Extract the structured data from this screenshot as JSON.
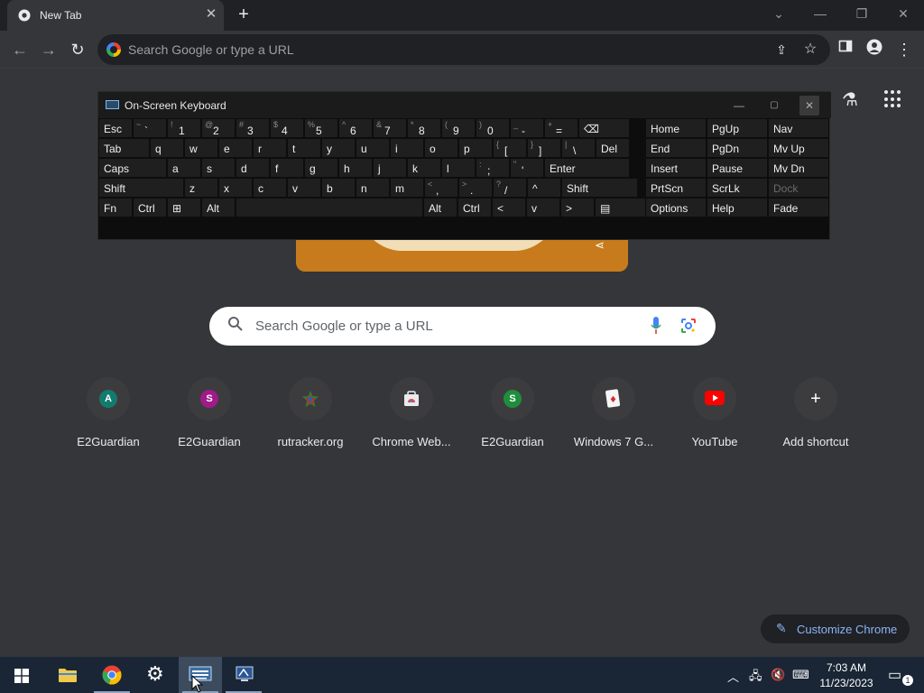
{
  "browser": {
    "tab_title": "New Tab",
    "tab_close": "✕",
    "new_tab": "+",
    "omnibox_placeholder": "Search Google or type a URL"
  },
  "ntp": {
    "search_placeholder": "Search Google or type a URL",
    "shortcuts": [
      {
        "label": "E2Guardian",
        "letter": "A",
        "color": "#137a6e"
      },
      {
        "label": "E2Guardian",
        "letter": "S",
        "color": "#a01a8a"
      },
      {
        "label": "rutracker.org",
        "letter": "",
        "color": "#3a3a3a"
      },
      {
        "label": "Chrome Web...",
        "letter": "",
        "color": "#3a3a3a"
      },
      {
        "label": "E2Guardian",
        "letter": "S",
        "color": "#1e8e3e"
      },
      {
        "label": "Windows 7 G...",
        "letter": "",
        "color": "#3a3a3a"
      },
      {
        "label": "YouTube",
        "letter": "",
        "color": "#ff0000"
      },
      {
        "label": "Add shortcut",
        "letter": "+",
        "color": "#3c3c3f"
      }
    ],
    "customize_label": "Customize Chrome"
  },
  "osk": {
    "title": "On-Screen Keyboard",
    "rows": [
      [
        [
          "Esc",
          ""
        ],
        [
          "`",
          "~"
        ],
        [
          "1",
          "!"
        ],
        [
          "2",
          "@"
        ],
        [
          "3",
          "#"
        ],
        [
          "4",
          "$"
        ],
        [
          "5",
          "%"
        ],
        [
          "6",
          "^"
        ],
        [
          "7",
          "&"
        ],
        [
          "8",
          "*"
        ],
        [
          "9",
          "("
        ],
        [
          "0",
          ")"
        ],
        [
          "-",
          "_"
        ],
        [
          "=",
          "+"
        ],
        [
          "⌫",
          ""
        ]
      ],
      [
        [
          "Tab",
          ""
        ],
        [
          "q",
          ""
        ],
        [
          "w",
          ""
        ],
        [
          "e",
          ""
        ],
        [
          "r",
          ""
        ],
        [
          "t",
          ""
        ],
        [
          "y",
          ""
        ],
        [
          "u",
          ""
        ],
        [
          "i",
          ""
        ],
        [
          "o",
          ""
        ],
        [
          "p",
          ""
        ],
        [
          "[",
          "{"
        ],
        [
          "]",
          "}"
        ],
        [
          "\\",
          "|"
        ],
        [
          "Del",
          ""
        ]
      ],
      [
        [
          "Caps",
          ""
        ],
        [
          "a",
          ""
        ],
        [
          "s",
          ""
        ],
        [
          "d",
          ""
        ],
        [
          "f",
          ""
        ],
        [
          "g",
          ""
        ],
        [
          "h",
          ""
        ],
        [
          "j",
          ""
        ],
        [
          "k",
          ""
        ],
        [
          "l",
          ""
        ],
        [
          ";",
          ":"
        ],
        [
          "'",
          "\""
        ],
        [
          "Enter",
          ""
        ]
      ],
      [
        [
          "Shift",
          ""
        ],
        [
          "z",
          ""
        ],
        [
          "x",
          ""
        ],
        [
          "c",
          ""
        ],
        [
          "v",
          ""
        ],
        [
          "b",
          ""
        ],
        [
          "n",
          ""
        ],
        [
          "m",
          ""
        ],
        [
          ",",
          "<"
        ],
        [
          ".",
          ">"
        ],
        [
          "/",
          "?"
        ],
        [
          "^",
          ""
        ],
        [
          "Shift",
          ""
        ]
      ],
      [
        [
          "Fn",
          ""
        ],
        [
          "Ctrl",
          ""
        ],
        [
          "⊞",
          ""
        ],
        [
          "Alt",
          ""
        ],
        [
          "",
          ""
        ],
        [
          "Alt",
          ""
        ],
        [
          "Ctrl",
          ""
        ],
        [
          "<",
          ""
        ],
        [
          "v",
          ""
        ],
        [
          ">",
          ""
        ],
        [
          "▤",
          ""
        ]
      ]
    ],
    "side_keys": [
      [
        "Home",
        "PgUp",
        "Nav"
      ],
      [
        "End",
        "PgDn",
        "Mv Up"
      ],
      [
        "Insert",
        "Pause",
        "Mv Dn"
      ],
      [
        "PrtScn",
        "ScrLk",
        "Dock"
      ],
      [
        "Options",
        "Help",
        "Fade"
      ]
    ]
  },
  "taskbar": {
    "time": "7:03 AM",
    "date": "11/23/2023",
    "notification_count": "1"
  }
}
